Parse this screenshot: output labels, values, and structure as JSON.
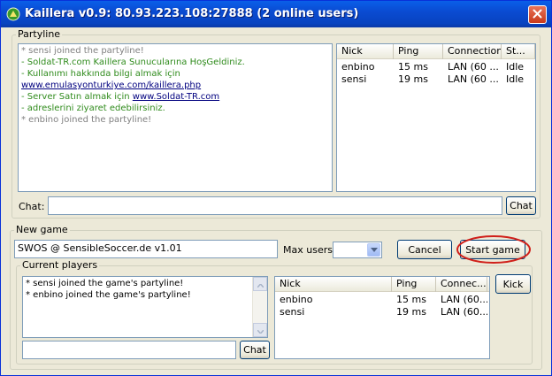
{
  "window": {
    "title": "Kaillera v0.9: 80.93.223.108:27888 (2 online users)"
  },
  "partyline": {
    "legend": "Partyline",
    "messages": [
      {
        "text": "* sensi joined the partyline!",
        "color": "#808080"
      },
      {
        "text": "- Soldat-TR.com Kaillera Sunucularına HoşGeldiniz.",
        "color": "#2f8b1c"
      },
      {
        "text": "- Kullanımı hakkında bilgi almak için",
        "color": "#2f8b1c"
      },
      {
        "text": "www.emulasyonturkiye.com/kaillera.php",
        "color": "#00007f"
      },
      {
        "text": "- Server Satın almak için ",
        "link": "www.Soldat-TR.com",
        "color": "#2f8b1c"
      },
      {
        "text": "- adreslerini ziyaret edebilirsiniz.",
        "color": "#2f8b1c"
      },
      {
        "text": "* enbino joined the partyline!",
        "color": "#808080"
      }
    ],
    "users_columns": [
      "Nick",
      "Ping",
      "Connection",
      "St..."
    ],
    "users": [
      {
        "nick": "enbino",
        "ping": "15 ms",
        "connection": "LAN (60 ...",
        "status": "Idle"
      },
      {
        "nick": "sensi",
        "ping": "19 ms",
        "connection": "LAN (60 ...",
        "status": "Idle"
      }
    ],
    "chat_label": "Chat:",
    "chat_value": "",
    "chat_button": "Chat"
  },
  "newgame": {
    "legend": "New game",
    "game_name": "SWOS @ SensibleSoccer.de v1.01",
    "max_users_label": "Max users:",
    "max_users_value": "",
    "cancel_button": "Cancel",
    "start_button": "Start game",
    "highlight_color": "#d0201a"
  },
  "current_players": {
    "legend": "Current players",
    "messages": [
      "* sensi joined the game's partyline!",
      "* enbino joined the game's partyline!"
    ],
    "chat_value": "",
    "chat_button": "Chat",
    "players_columns": [
      "Nick",
      "Ping",
      "Connec..."
    ],
    "players": [
      {
        "nick": "enbino",
        "ping": "15 ms",
        "connection": "LAN (60..."
      },
      {
        "nick": "sensi",
        "ping": "19 ms",
        "connection": "LAN (60..."
      }
    ],
    "kick_button": "Kick"
  },
  "icons": {
    "app": "kaillera-app-icon",
    "close": "close-icon"
  }
}
